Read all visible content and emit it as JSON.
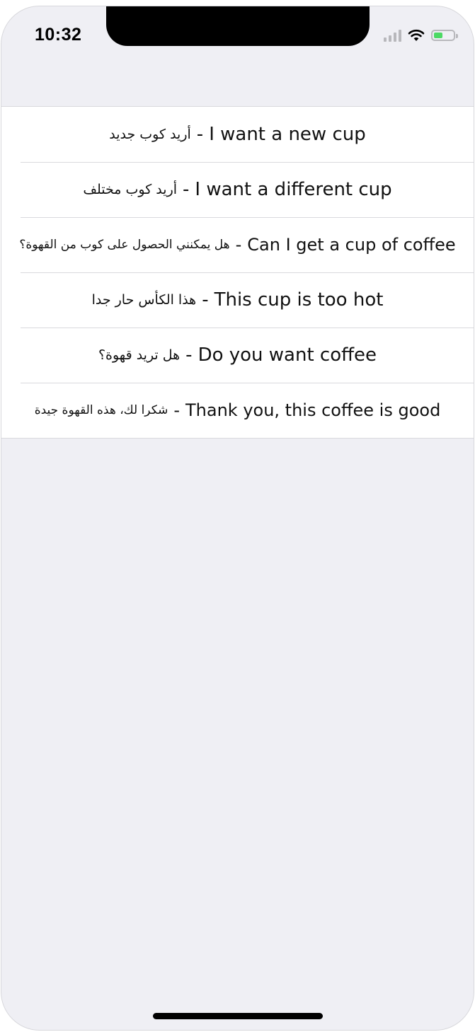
{
  "status_bar": {
    "time": "10:32"
  },
  "phrases": [
    {
      "arabic": "أريد كوب جديد",
      "separator": "-",
      "english": "I want a new cup"
    },
    {
      "arabic": "أريد كوب مختلف",
      "separator": "-",
      "english": "I want a different cup"
    },
    {
      "arabic": "هل يمكنني الحصول على كوب من القهوة؟",
      "separator": "-",
      "english": "Can I get a cup of coffee"
    },
    {
      "arabic": "هذا الكأس حار جدا",
      "separator": "-",
      "english": "This cup is too hot"
    },
    {
      "arabic": "هل تريد قهوة؟",
      "separator": "-",
      "english": "Do you want coffee"
    },
    {
      "arabic": "شكرا لك، هذه القهوة جيدة",
      "separator": "-",
      "english": "Thank you, this coffee is good"
    }
  ],
  "icons": [
    "cellular-signal-icon",
    "wifi-icon",
    "battery-icon"
  ],
  "colors": {
    "background": "#efeff4",
    "cell": "#ffffff",
    "separator": "#d9d9dd",
    "battery": "#4cd964"
  }
}
